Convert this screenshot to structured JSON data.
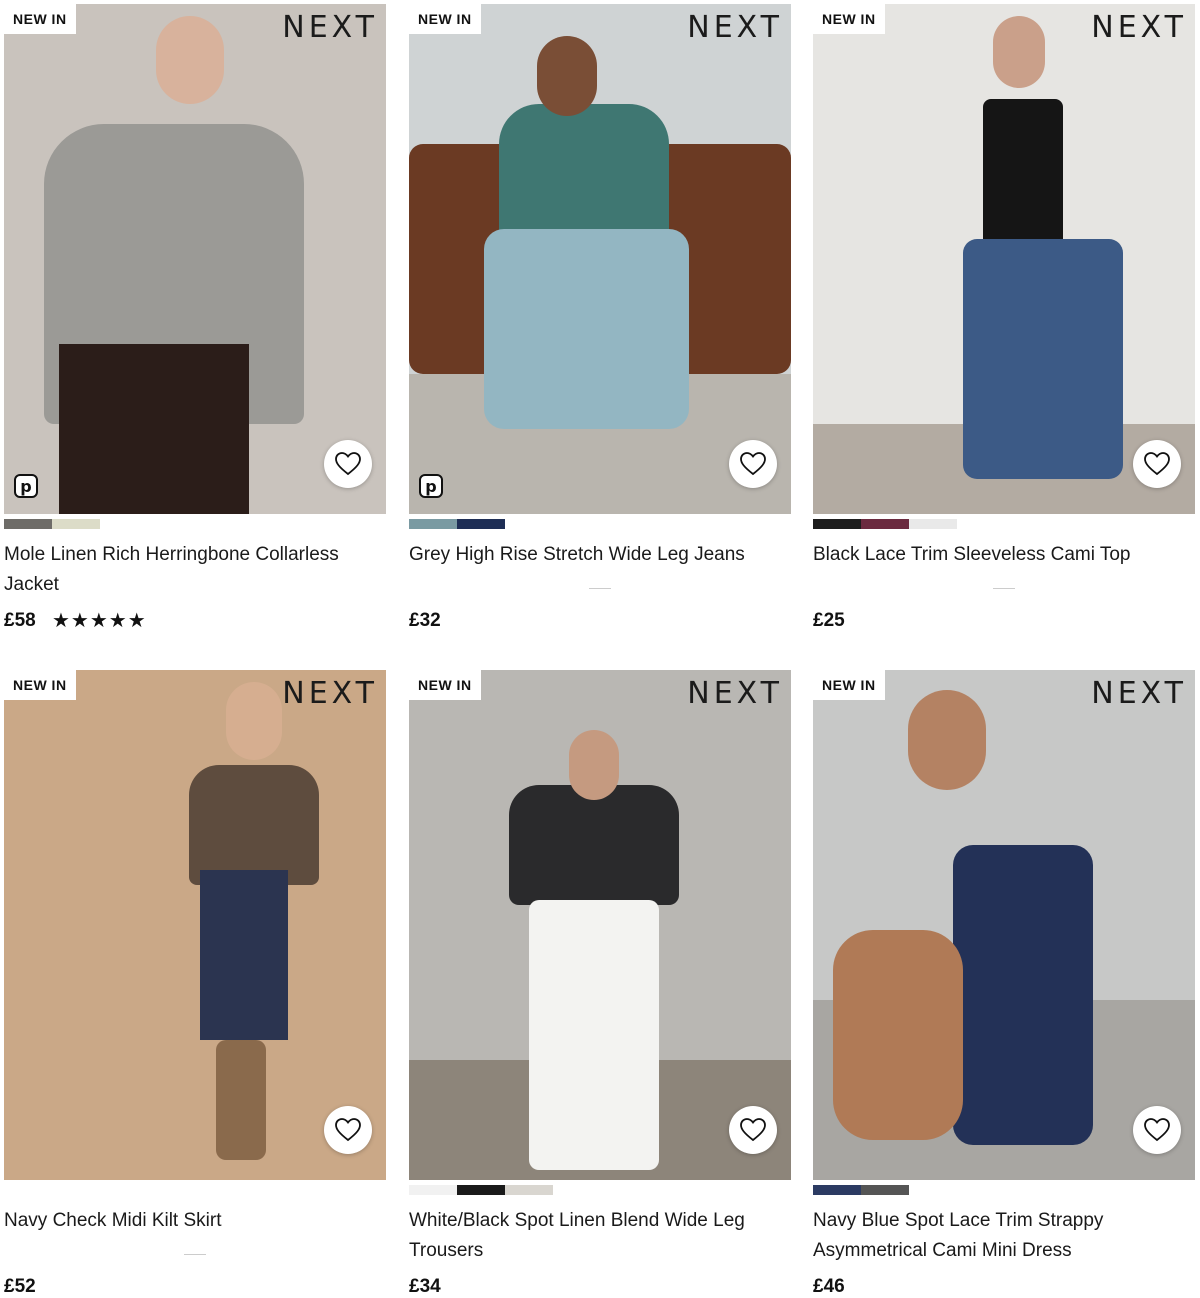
{
  "products": [
    {
      "badge": "NEW IN",
      "brand": "NEXT",
      "title": "Mole Linen Rich Herringbone Collarless Jacket",
      "price": "£58",
      "rating": "★★★★★",
      "swatches": [
        "#6e6c68",
        "#dcdcc8"
      ],
      "bg": "#c9c3bd",
      "p_badge": "p"
    },
    {
      "badge": "NEW IN",
      "brand": "NEXT",
      "title": "Grey High Rise Stretch Wide Leg Jeans",
      "price": "£32",
      "swatches": [
        "#7a9aa2",
        "#1e2e55"
      ],
      "bg": "#cfd3d4",
      "p_badge": "p"
    },
    {
      "badge": "NEW IN",
      "brand": "NEXT",
      "title": "Black Lace Trim Sleeveless Cami Top",
      "price": "£25",
      "swatches": [
        "#1d1d1d",
        "#6b2a3f",
        "#e9e9e9"
      ],
      "bg": "#e6e5e2"
    },
    {
      "badge": "NEW IN",
      "brand": "NEXT",
      "title": "Navy Check Midi Kilt Skirt",
      "price": "£52",
      "swatches": [],
      "bg": "#caa887"
    },
    {
      "badge": "NEW IN",
      "brand": "NEXT",
      "title": "White/Black Spot Linen Blend Wide Leg Trousers",
      "price": "£34",
      "swatches": [
        "#f1f1f1",
        "#1a1a1a",
        "#d9d6d0"
      ],
      "bg": "#b9b7b3"
    },
    {
      "badge": "NEW IN",
      "brand": "NEXT",
      "title": "Navy Blue Spot Lace Trim Strappy Asymmetrical Cami Mini Dress",
      "price": "£46",
      "swatches": [
        "#2c3b63",
        "#555555"
      ],
      "bg": "#c7c8c7"
    }
  ]
}
